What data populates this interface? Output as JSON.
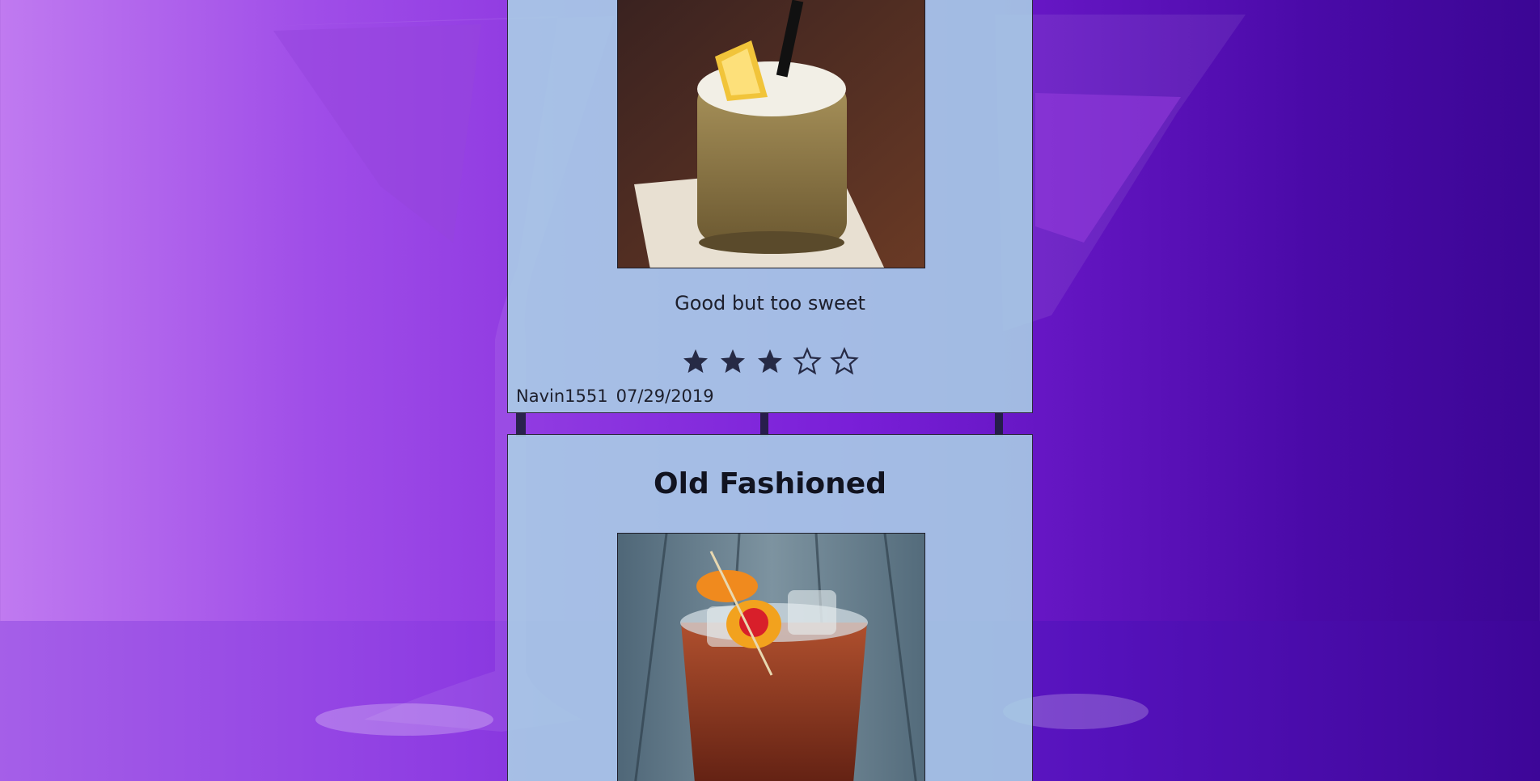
{
  "reviews": [
    {
      "text": "Good but too sweet",
      "rating": 3,
      "rating_max": 5,
      "user": "Navin1551",
      "date": "07/29/2019"
    }
  ],
  "drinks": [
    {
      "title": "Old Fashioned"
    }
  ],
  "icons": {
    "star_filled": "star-filled-icon",
    "star_empty": "star-outline-icon"
  },
  "colors": {
    "card_bg": "#aad2e6",
    "star": "#262a45",
    "background_purple": "#7a1fd8"
  }
}
